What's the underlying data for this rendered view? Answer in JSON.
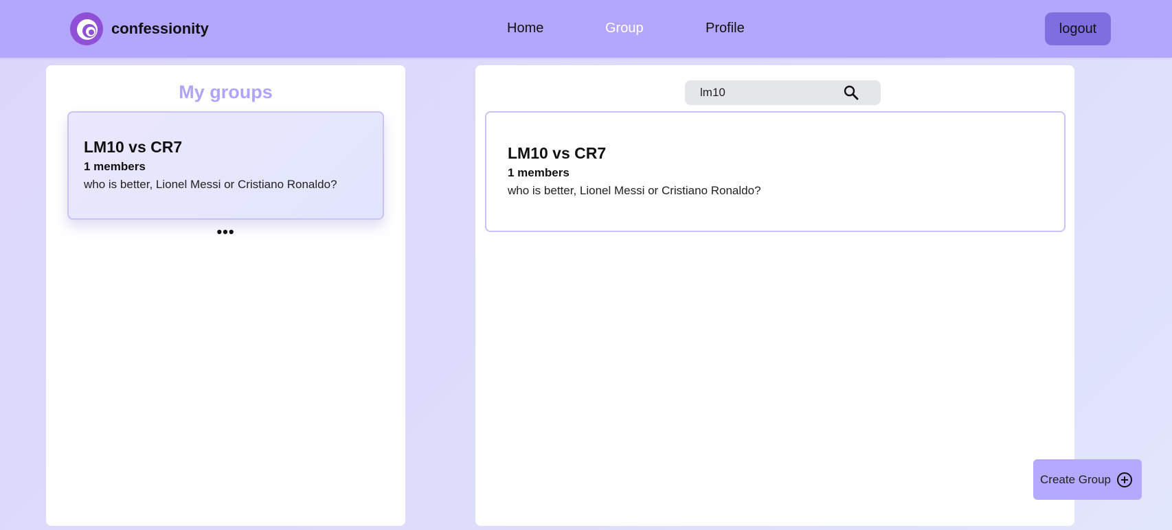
{
  "brand": {
    "name": "confessionity",
    "logo_icon": "swirl-logo-icon"
  },
  "nav": {
    "links": [
      {
        "label": "Home"
      },
      {
        "label": "Group",
        "active": true
      },
      {
        "label": "Profile"
      }
    ],
    "logout_label": "logout"
  },
  "my_groups": {
    "title": "My groups",
    "groups": [
      {
        "title": "LM10 vs CR7",
        "members": "1 members",
        "description": "who is better, Lionel Messi or Cristiano Ronaldo?"
      }
    ],
    "more_label": "•••"
  },
  "search": {
    "value": "lm10",
    "icon": "search-icon"
  },
  "results": [
    {
      "title": "LM10 vs CR7",
      "members": "1 members",
      "description": "who is better, Lionel Messi or Cristiano Ronaldo?"
    }
  ],
  "create_group": {
    "label": "Create Group",
    "icon": "plus-circle-icon"
  },
  "colors": {
    "navbar": "#b3a6fd",
    "accent_dark": "#7d6fe0",
    "title_accent": "#b1a4f8",
    "active_link": "#ffffff",
    "card_border": "#c9c2f7",
    "create_button": "#b5a9fd"
  }
}
